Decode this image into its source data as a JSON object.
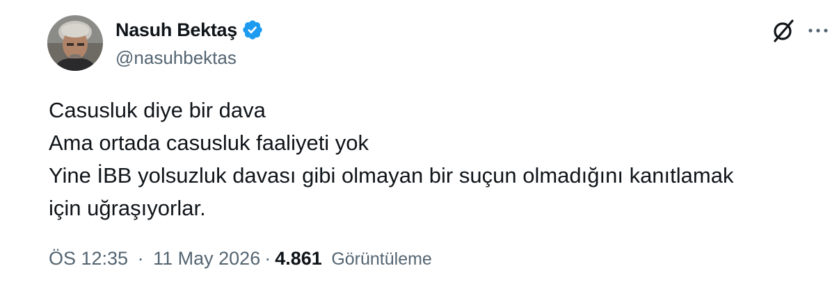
{
  "author": {
    "display_name": "Nasuh Bektaş",
    "handle": "@nasuhbektas",
    "verified": true,
    "verified_color": "#1d9bf0"
  },
  "icons": {
    "avatar": "avatar-photo",
    "verified": "verified-badge-icon",
    "grok": "grok-icon",
    "more": "more-options-icon"
  },
  "tweet": {
    "lines": [
      "Casusluk diye bir dava",
      "Ama ortada casusluk faaliyeti yok",
      "Yine İBB yolsuzluk davası gibi olmayan bir suçun olmadığını kanıtlamak",
      "için uğraşıyorlar."
    ]
  },
  "meta": {
    "time": "ÖS 12:35",
    "separator": "·",
    "date": "11 May 2026",
    "views_count": "4.861",
    "views_label": "Görüntüleme"
  },
  "colors": {
    "text_primary": "#0f1419",
    "text_secondary": "#536471",
    "accent": "#1d9bf0"
  }
}
